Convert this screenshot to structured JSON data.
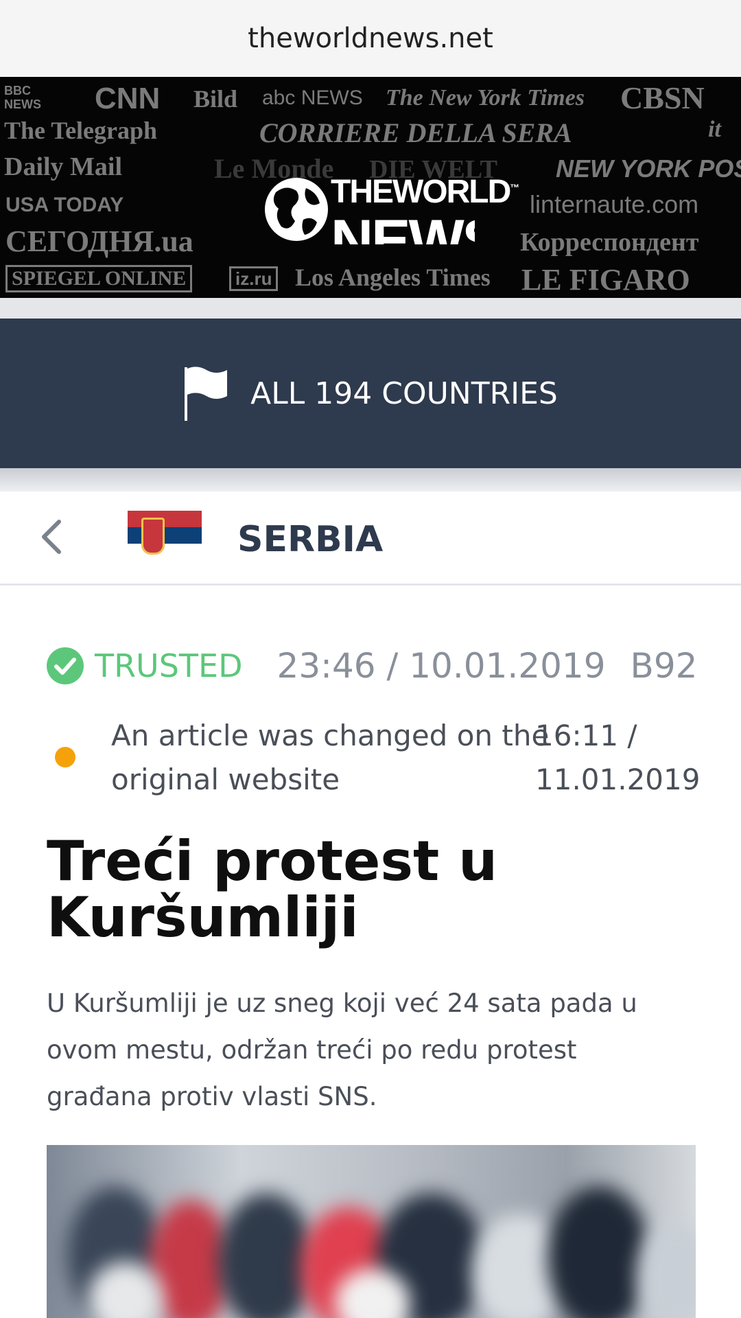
{
  "browser": {
    "url": "theworldnews.net"
  },
  "banner": {
    "logos": [
      "BBC NEWS",
      "CNN",
      "Bild",
      "abc NEWS",
      "The New York Times",
      "CBSN",
      "The Telegraph",
      "CORRIERE DELLA SERA",
      "it",
      "Daily Mail",
      "Le Monde",
      "DIE WELT",
      "NEW YORK POST",
      "USA TODAY",
      "linternaute.com",
      "СЕГОДНЯ.ua",
      "Корреспондент",
      "SPIEGEL ONLINE",
      "iz.ru",
      "Los Angeles Times",
      "LE FIGARO"
    ],
    "brand_the": "THEWORLD",
    "brand_tm": "™",
    "brand_news": "NEWS"
  },
  "nav": {
    "countries_label": "ALL 194 COUNTRIES",
    "icon": "flag-icon"
  },
  "country": {
    "name": "SERBIA",
    "flag_colors": [
      "#c6363c",
      "#0c4076",
      "#ffffff"
    ]
  },
  "article": {
    "trust_label": "TRUSTED",
    "timestamp": "23:46 / 10.01.2019",
    "source": "B92",
    "changed_text": "An article was changed on the original website",
    "changed_time": "16:11 / 11.01.2019",
    "title": "Treći protest u Kuršumliji",
    "summary": "U Kuršumliji je uz sneg koji već 24 sata pada u ovom mestu, održan treći po redu protest građana protiv vlasti SNS."
  },
  "colors": {
    "nav_bg": "#2e3a4d",
    "trusted": "#5cc77a",
    "changed_dot": "#f5a20a"
  }
}
